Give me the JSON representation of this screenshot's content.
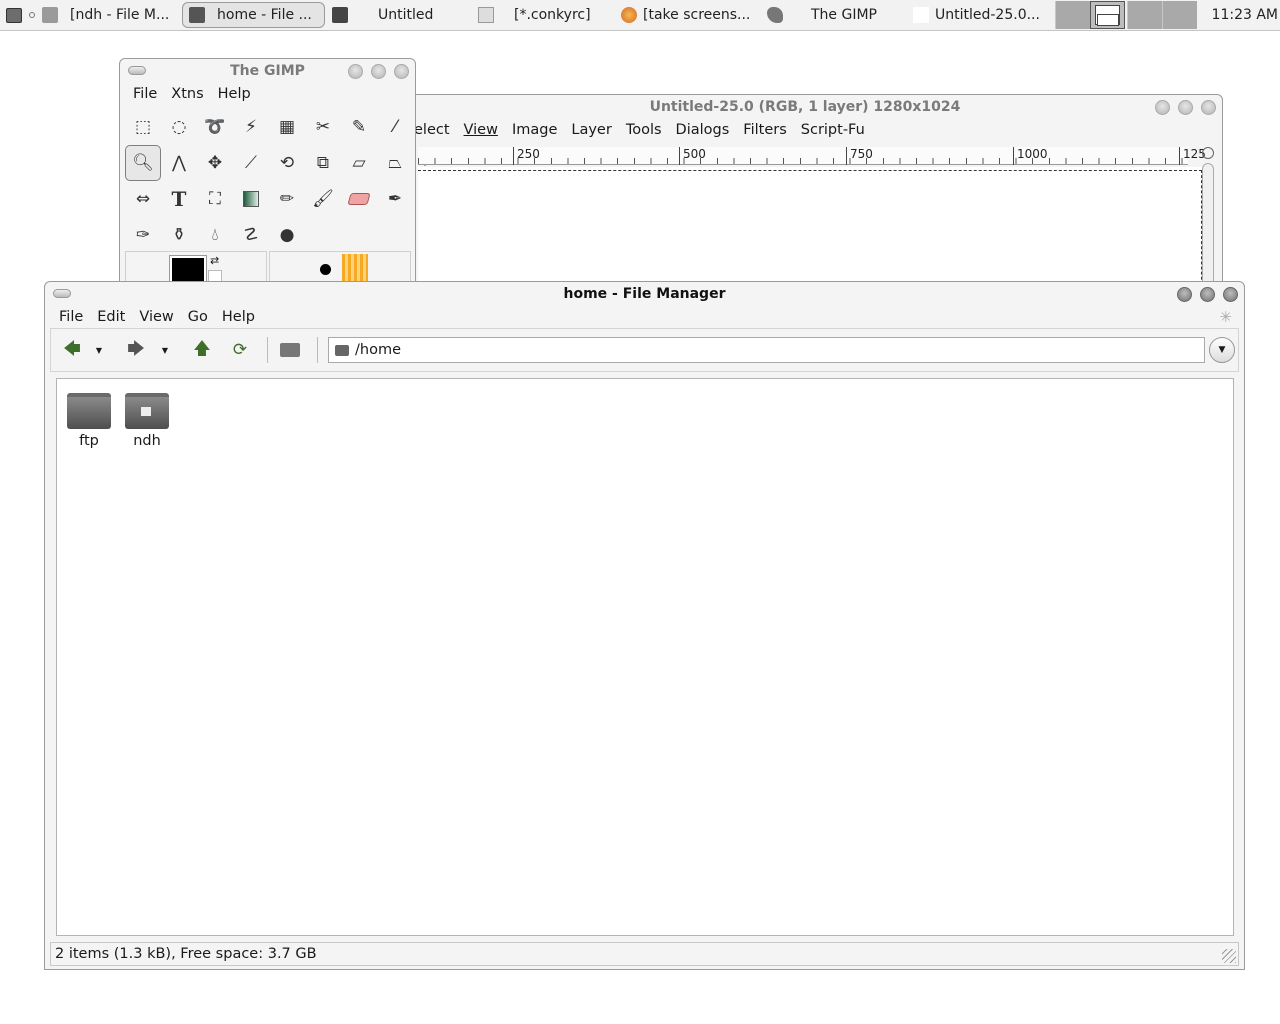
{
  "taskbar": {
    "tasks": [
      {
        "label": "[ndh - File M..."
      },
      {
        "label": "home - File ..."
      },
      {
        "label": "Untitled"
      },
      {
        "label": "[*.conkyrc]"
      },
      {
        "label": "[take screens..."
      },
      {
        "label": "The GIMP"
      },
      {
        "label": "Untitled-25.0..."
      }
    ],
    "clock": "11:23 AM"
  },
  "gimp_toolbox": {
    "title": "The GIMP",
    "menu": {
      "file": "File",
      "xtns": "Xtns",
      "help": "Help"
    }
  },
  "gimp_image": {
    "title": "Untitled-25.0 (RGB, 1 layer) 1280x1024",
    "menu": {
      "select": "elect",
      "view": "View",
      "image": "Image",
      "layer": "Layer",
      "tools": "Tools",
      "dialogs": "Dialogs",
      "filters": "Filters",
      "script_fu": "Script-Fu"
    },
    "ruler": [
      "250",
      "500",
      "750",
      "1000",
      "125"
    ]
  },
  "file_manager": {
    "title": "home - File Manager",
    "menu": {
      "file": "File",
      "edit": "Edit",
      "view": "View",
      "go": "Go",
      "help": "Help"
    },
    "path": "/home",
    "items": [
      {
        "name": "ftp"
      },
      {
        "name": "ndh"
      }
    ],
    "status": "2 items (1.3 kB), Free space: 3.7 GB"
  }
}
